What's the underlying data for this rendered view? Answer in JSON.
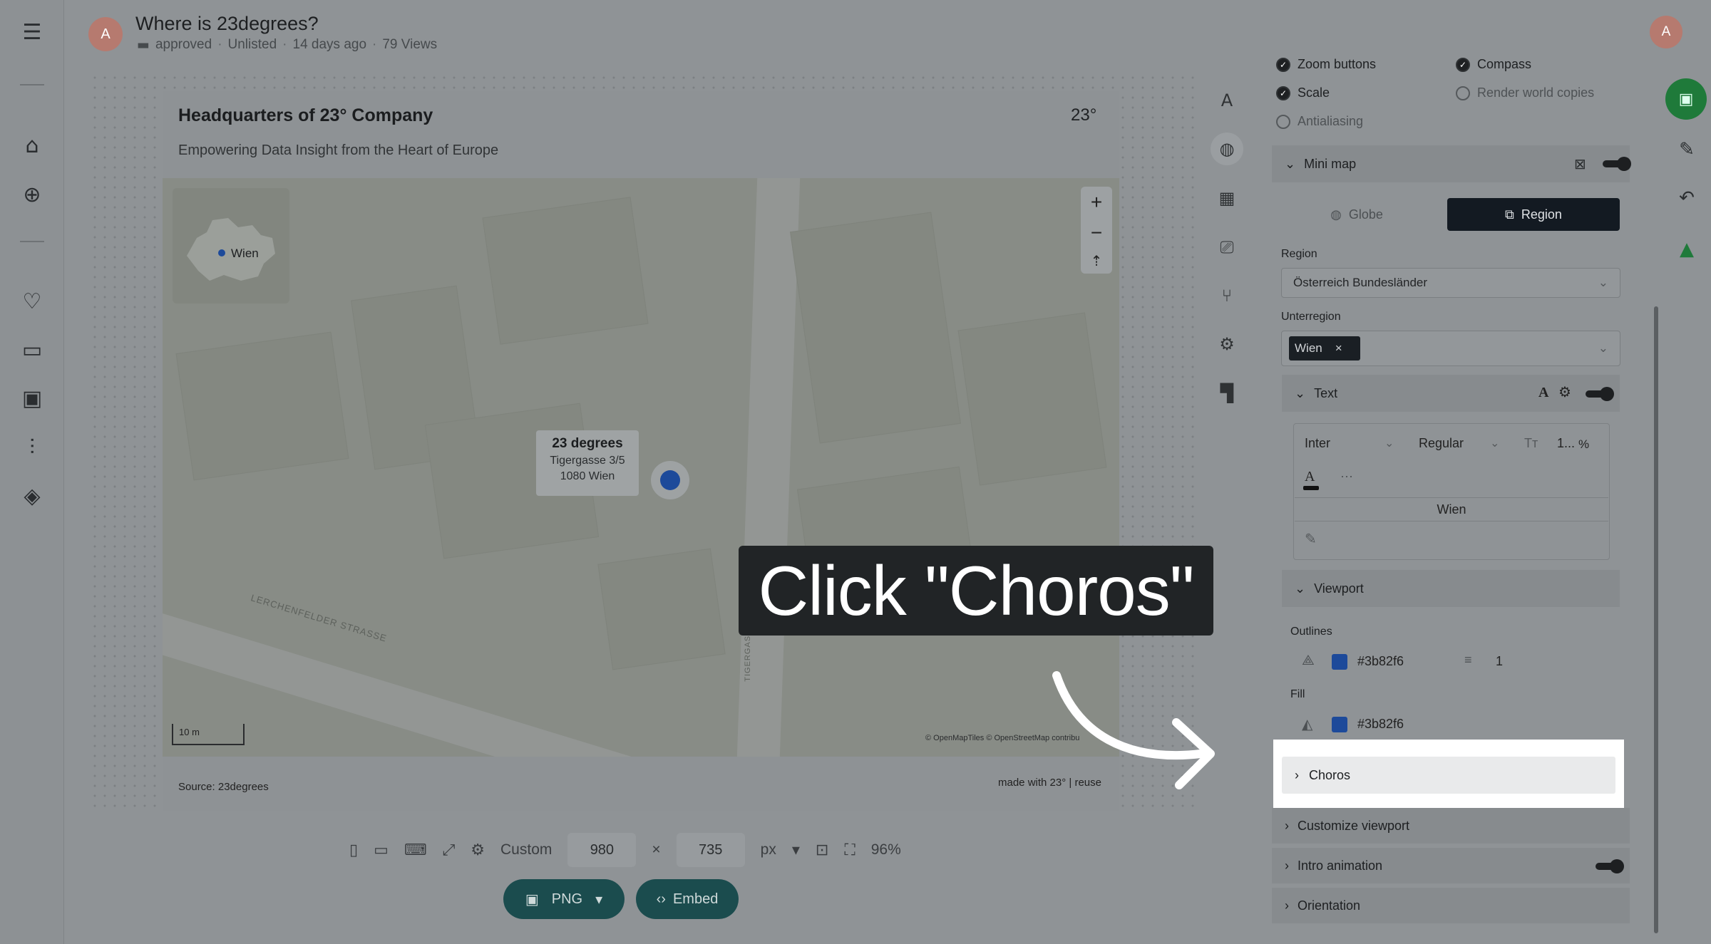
{
  "header": {
    "avatar_initial": "A",
    "title": "Where is 23degrees?",
    "status": "approved",
    "visibility": "Unlisted",
    "age": "14 days ago",
    "views": "79 Views"
  },
  "map_card": {
    "title": "Headquarters of 23° Company",
    "subtitle": "Empowering Data Insight from the Heart of Europe",
    "logo_text": "23°",
    "minimap_label": "Wien",
    "zoom_in": "+",
    "zoom_out": "−",
    "compass": "⇡",
    "popup": {
      "title": "23 degrees",
      "line1": "Tigergasse 3/5",
      "line2": "1080 Wien"
    },
    "scale_label": "10 m",
    "attribution": "© OpenMapTiles © OpenStreetMap contribu",
    "street_1": "LERCHENFELDER STRASSE",
    "street_2": "TIGERGASSE",
    "source": "Source: 23degrees",
    "made_with": "made with 23° | reuse"
  },
  "bottom_bar": {
    "preset_label": "Custom",
    "width": "980",
    "height": "735",
    "times": "×",
    "unit": "px",
    "zoom": "96%",
    "png_label": "PNG",
    "embed_label": "Embed"
  },
  "panel": {
    "checkboxes": {
      "zoom_buttons": "Zoom buttons",
      "compass": "Compass",
      "scale": "Scale",
      "render_world_copies": "Render world copies",
      "antialiasing": "Antialiasing"
    },
    "minimap_section": "Mini map",
    "seg_globe": "Globe",
    "seg_region": "Region",
    "region_label": "Region",
    "region_value": "Österreich Bundesländer",
    "subregion_label": "Unterregion",
    "subregion_tag": "Wien",
    "text_section": "Text",
    "font_family": "Inter",
    "font_weight": "Regular",
    "font_size": "1...",
    "font_unit": "%",
    "text_value": "Wien",
    "viewport_section": "Viewport",
    "outlines_label": "Outlines",
    "outline_color": "#3b82f6",
    "outline_width": "1",
    "fill_label": "Fill",
    "fill_color": "#3b82f6",
    "choros": "Choros",
    "customize_viewport": "Customize viewport",
    "intro_animation": "Intro animation",
    "orientation": "Orientation"
  },
  "callout": {
    "text": "Click \"Choros\""
  },
  "colors": {
    "accent": "#3b82f6",
    "button_teal": "#1b4c4e",
    "save_green": "#1f7a3a"
  }
}
